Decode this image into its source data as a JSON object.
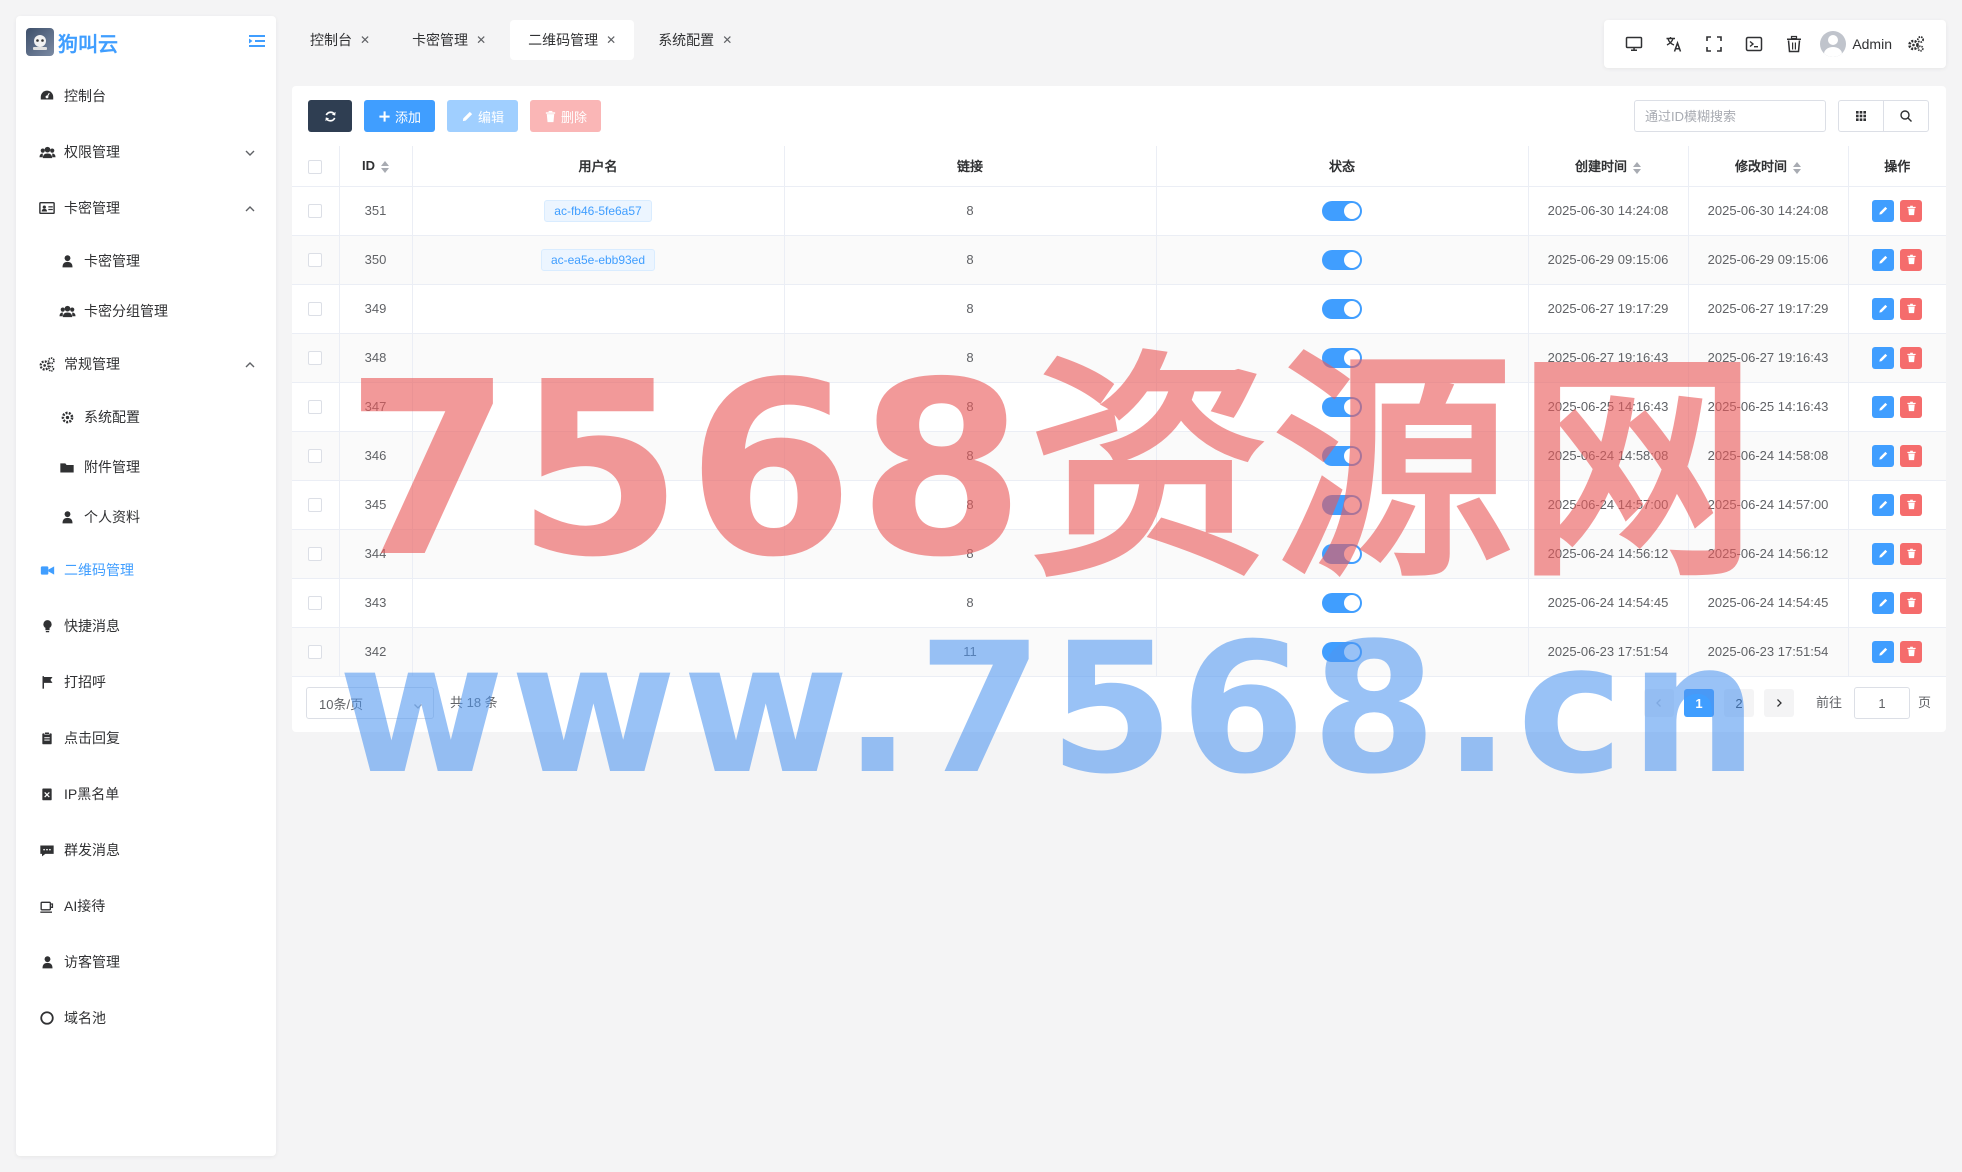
{
  "logo": {
    "text": "狗叫云"
  },
  "sidebar": {
    "items": [
      {
        "label": "控制台",
        "icon": "dashboard-icon"
      },
      {
        "label": "权限管理",
        "icon": "users-icon"
      },
      {
        "label": "卡密管理",
        "icon": "card-icon"
      },
      {
        "label": "卡密管理",
        "icon": "user-icon"
      },
      {
        "label": "卡密分组管理",
        "icon": "users-icon"
      },
      {
        "label": "常规管理",
        "icon": "gears-icon"
      },
      {
        "label": "系统配置",
        "icon": "gear-icon"
      },
      {
        "label": "附件管理",
        "icon": "folder-icon"
      },
      {
        "label": "个人资料",
        "icon": "user-icon"
      },
      {
        "label": "二维码管理",
        "icon": "qrcode-icon"
      },
      {
        "label": "快捷消息",
        "icon": "bulb-icon"
      },
      {
        "label": "打招呼",
        "icon": "flag-icon"
      },
      {
        "label": "点击回复",
        "icon": "clipboard-icon"
      },
      {
        "label": "IP黑名单",
        "icon": "ban-icon"
      },
      {
        "label": "群发消息",
        "icon": "message-icon"
      },
      {
        "label": "AI接待",
        "icon": "coffee-icon"
      },
      {
        "label": "访客管理",
        "icon": "user-icon"
      },
      {
        "label": "域名池",
        "icon": "circle-icon"
      }
    ]
  },
  "tabs": [
    {
      "label": "控制台"
    },
    {
      "label": "卡密管理"
    },
    {
      "label": "二维码管理"
    },
    {
      "label": "系统配置"
    }
  ],
  "topbar": {
    "user_name": "Admin"
  },
  "toolbar": {
    "add_label": "添加",
    "edit_label": "编辑",
    "delete_label": "删除"
  },
  "search": {
    "placeholder": "通过ID模糊搜索"
  },
  "table": {
    "headers": {
      "id": "ID",
      "username": "用户名",
      "link": "链接",
      "status": "状态",
      "created": "创建时间",
      "modified": "修改时间",
      "ops": "操作"
    },
    "rows": [
      {
        "id": "351",
        "username": "ac-fb46-5fe6a57",
        "link": "8",
        "created": "2025-06-30 14:24:08",
        "modified": "2025-06-30 14:24:08"
      },
      {
        "id": "350",
        "username": "ac-ea5e-ebb93ed",
        "link": "8",
        "created": "2025-06-29 09:15:06",
        "modified": "2025-06-29 09:15:06"
      },
      {
        "id": "349",
        "username": "",
        "link": "8",
        "created": "2025-06-27 19:17:29",
        "modified": "2025-06-27 19:17:29"
      },
      {
        "id": "348",
        "username": "",
        "link": "8",
        "created": "2025-06-27 19:16:43",
        "modified": "2025-06-27 19:16:43"
      },
      {
        "id": "347",
        "username": "",
        "link": "8",
        "created": "2025-06-25 14:16:43",
        "modified": "2025-06-25 14:16:43"
      },
      {
        "id": "346",
        "username": "",
        "link": "8",
        "created": "2025-06-24 14:58:08",
        "modified": "2025-06-24 14:58:08"
      },
      {
        "id": "345",
        "username": "",
        "link": "8",
        "created": "2025-06-24 14:57:00",
        "modified": "2025-06-24 14:57:00"
      },
      {
        "id": "344",
        "username": "",
        "link": "8",
        "created": "2025-06-24 14:56:12",
        "modified": "2025-06-24 14:56:12"
      },
      {
        "id": "343",
        "username": "",
        "link": "8",
        "created": "2025-06-24 14:54:45",
        "modified": "2025-06-24 14:54:45"
      },
      {
        "id": "342",
        "username": "",
        "link": "11",
        "created": "2025-06-23 17:51:54",
        "modified": "2025-06-23 17:51:54"
      }
    ]
  },
  "pagination": {
    "page_size": "10条/页",
    "total": "共 18 条",
    "pages": [
      "1",
      "2"
    ],
    "goto_label": "前往",
    "goto_value": "1",
    "page_unit": "页"
  },
  "watermark": {
    "line1": "7568资源网",
    "line2": "www.7568.cn"
  },
  "colors": {
    "primary": "#409eff",
    "danger": "#f56c6c",
    "dark": "#2f3e52"
  }
}
